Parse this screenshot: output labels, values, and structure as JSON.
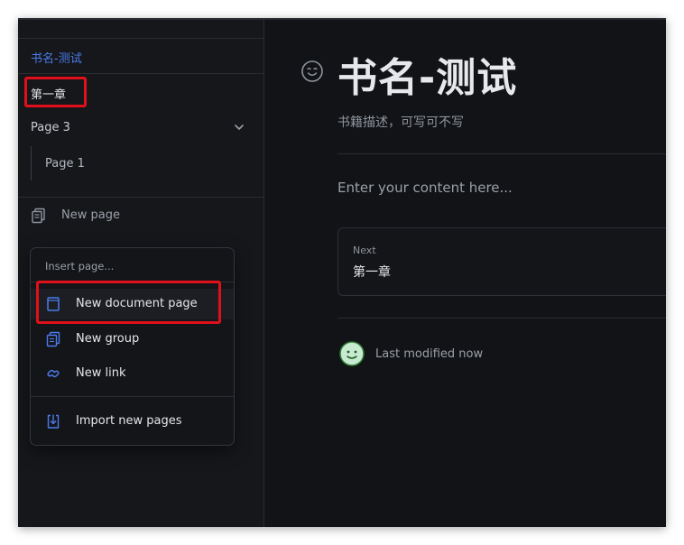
{
  "sidebar": {
    "space_name": "书名-测试",
    "pages": {
      "chapter": "第一章",
      "page3": "Page 3",
      "page1": "Page 1"
    },
    "new_page_label": "New page"
  },
  "menu": {
    "header": "Insert page...",
    "items": [
      {
        "label": "New document page",
        "icon": "document-icon"
      },
      {
        "label": "New group",
        "icon": "group-icon"
      },
      {
        "label": "New link",
        "icon": "link-icon"
      },
      {
        "label": "Import new pages",
        "icon": "import-icon"
      }
    ]
  },
  "main": {
    "title": "书名-测试",
    "description": "书籍描述，可写可不写",
    "content_placeholder": "Enter your content here...",
    "next": {
      "label": "Next",
      "title": "第一章"
    },
    "last_modified": "Last modified now"
  },
  "colors": {
    "background": "#121316",
    "sidebar": "#16171b",
    "accent": "#4b7bec",
    "highlight": "#e0101a",
    "avatar_green": "#2e7d32"
  }
}
